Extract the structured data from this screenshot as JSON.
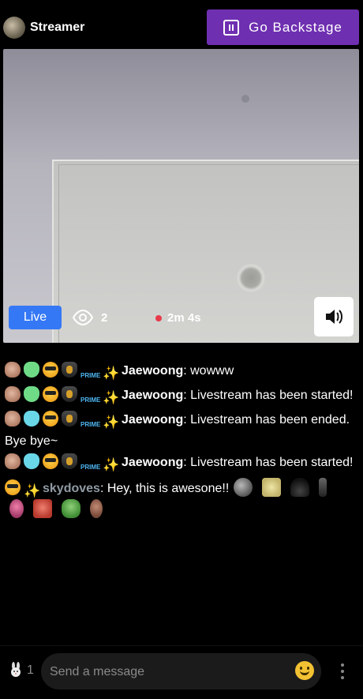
{
  "header": {
    "streamer_name": "Streamer",
    "backstage_label": "Go Backstage"
  },
  "video": {
    "live_label": "Live",
    "viewer_count": "2",
    "duration": "2m 4s"
  },
  "chat": {
    "messages": [
      {
        "user": "Jaewoong",
        "text": ": wowww"
      },
      {
        "user": "Jaewoong",
        "text": ": Livestream has been started!"
      },
      {
        "user": "Jaewoong",
        "text": ": Livestream has been ended. Bye bye~"
      },
      {
        "user": "Jaewoong",
        "text": ": Livestream has been started!"
      },
      {
        "user": "skydoves",
        "text": ": Hey, this is awesone!!"
      }
    ]
  },
  "footer": {
    "user_count": "1",
    "input_placeholder": "Send a message"
  },
  "colors": {
    "accent": "#6f2fb1",
    "live": "#3478f6",
    "rec": "#e83a4a"
  },
  "icons": [
    "pause-icon",
    "eye-icon",
    "speaker-icon",
    "bunny-icon",
    "smile-icon",
    "more-icon"
  ]
}
